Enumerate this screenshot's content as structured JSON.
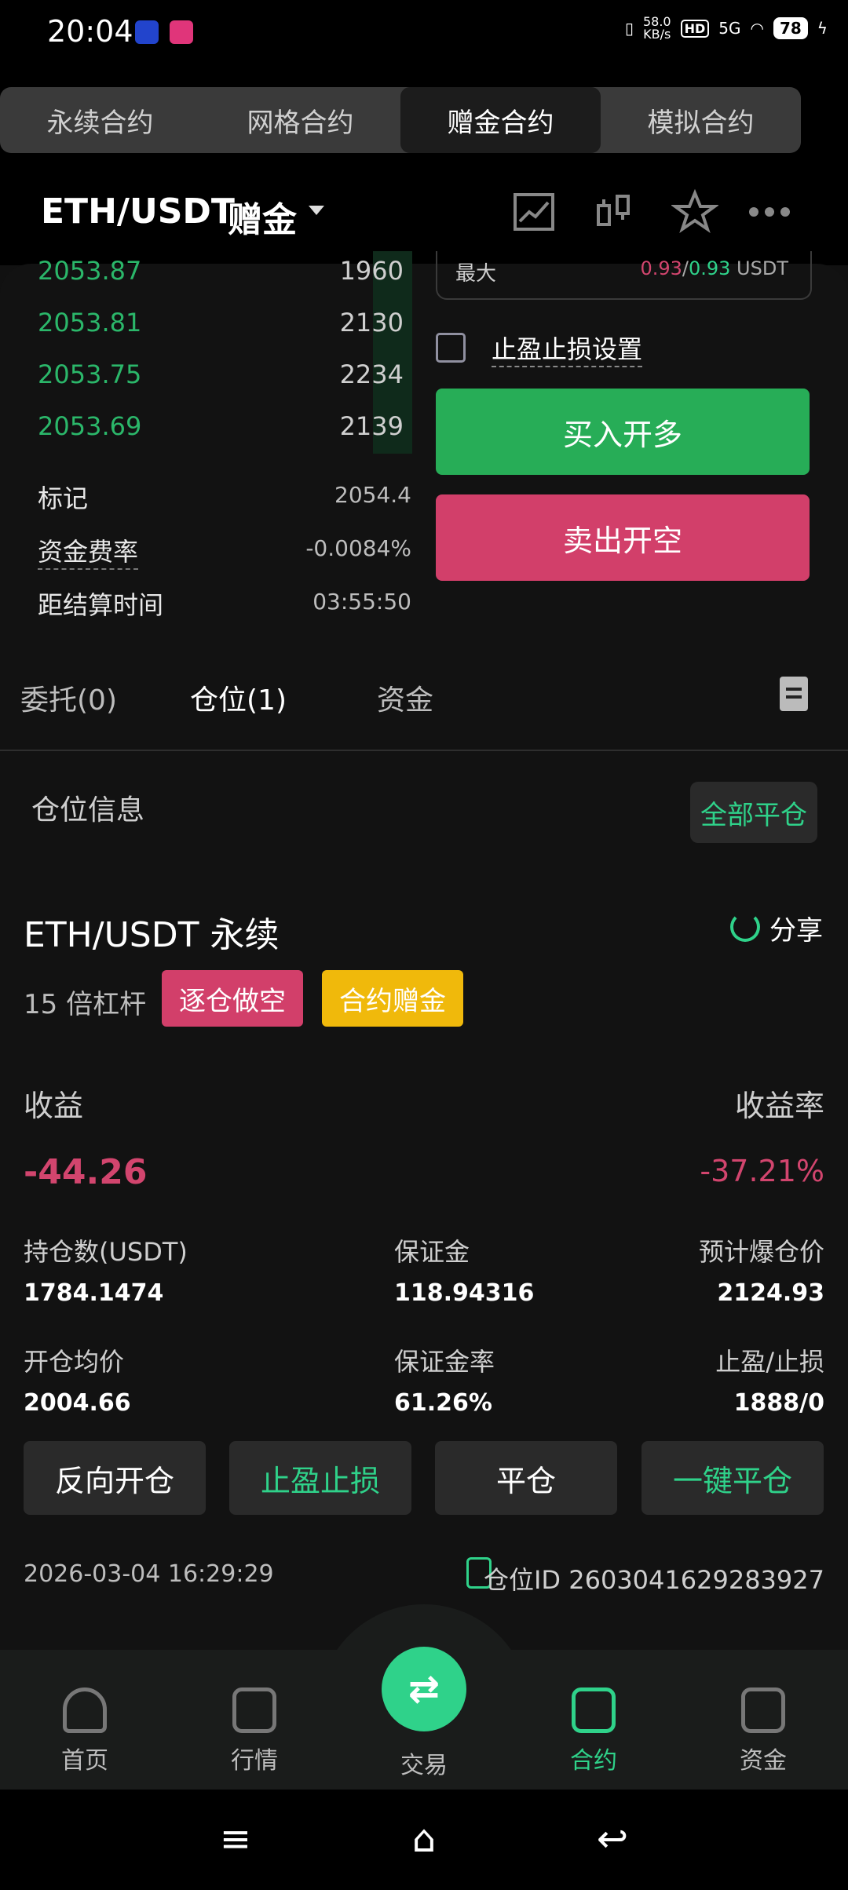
{
  "status": {
    "time": "20:04",
    "speed": "58.0",
    "speed_unit": "KB/s",
    "hd": "HD",
    "net": "5G",
    "battery": "78"
  },
  "tabs": [
    {
      "label": "永续合约",
      "active": false
    },
    {
      "label": "网格合约",
      "active": false
    },
    {
      "label": "赠金合约",
      "active": true
    },
    {
      "label": "模拟合约",
      "active": false
    }
  ],
  "header": {
    "pair": "ETH/USDT",
    "tag": "赠金",
    "icons": [
      "chart-line-icon",
      "candlestick-icon",
      "star-icon",
      "more-icon"
    ]
  },
  "orderbook": [
    {
      "price": "2053.87",
      "qty": "1960"
    },
    {
      "price": "2053.81",
      "qty": "2130"
    },
    {
      "price": "2053.75",
      "qty": "2234"
    },
    {
      "price": "2053.69",
      "qty": "2139"
    }
  ],
  "market_info": {
    "mark_label": "标记",
    "mark_value": "2054.4",
    "funding_label": "资金费率",
    "funding_value": "-0.0084%",
    "settle_label": "距结算时间",
    "settle_value": "03:55:50"
  },
  "order_form": {
    "max_label": "最大",
    "max_a": "0.93",
    "max_sep": "/",
    "max_b": "0.93",
    "max_unit": "USDT",
    "tpsl_label": "止盈止损设置",
    "buy_label": "买入开多",
    "sell_label": "卖出开空"
  },
  "subtabs": [
    {
      "label": "委托(0)",
      "active": false
    },
    {
      "label": "仓位(1)",
      "active": true
    },
    {
      "label": "资金",
      "active": false
    }
  ],
  "position_section": {
    "title": "仓位信息",
    "close_all": "全部平仓"
  },
  "position": {
    "title": "ETH/USDT 永续",
    "share": "分享",
    "leverage": "15 倍杠杆",
    "side_badge": "逐仓做空",
    "bonus_badge": "合约赠金",
    "pnl_label": "收益",
    "pnl_value": "-44.26",
    "rate_label": "收益率",
    "rate_value": "-37.21%",
    "size_label": "持仓数(USDT)",
    "size_value": "1784.1474",
    "margin_label": "保证金",
    "margin_value": "118.94316",
    "liq_label": "预计爆仓价",
    "liq_value": "2124.93",
    "entry_label": "开仓均价",
    "entry_value": "2004.66",
    "margin_rate_label": "保证金率",
    "margin_rate_value": "61.26%",
    "tpsl_label": "止盈/止损",
    "tpsl_value": "1888/0",
    "btn_reverse": "反向开仓",
    "btn_tpsl": "止盈止损",
    "btn_close": "平仓",
    "btn_quick_close": "一键平仓",
    "time": "2026-03-04 16:29:29",
    "position_id": "仓位ID 2603041629283927"
  },
  "nav": [
    {
      "label": "首页",
      "active": false
    },
    {
      "label": "行情",
      "active": false
    },
    {
      "label": "交易",
      "active": false
    },
    {
      "label": "合约",
      "active": true
    },
    {
      "label": "资金",
      "active": false
    }
  ],
  "colors": {
    "green": "#2fd28a",
    "buy": "#27ad57",
    "sell": "#d23f6a",
    "bonus": "#f0b90b"
  }
}
